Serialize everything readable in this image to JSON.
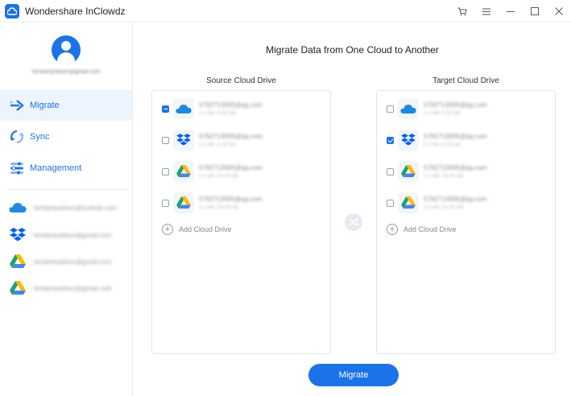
{
  "app": {
    "title": "Wondershare InClowdz"
  },
  "window_controls": [
    "cart-icon",
    "menu-icon",
    "minimize-icon",
    "maximize-icon",
    "close-icon"
  ],
  "sidebar": {
    "user_email": "kimberlywilson@gmail.com",
    "nav": [
      {
        "label": "Migrate",
        "icon": "migrate-icon",
        "active": true
      },
      {
        "label": "Sync",
        "icon": "sync-icon",
        "active": false
      },
      {
        "label": "Management",
        "icon": "management-icon",
        "active": false
      }
    ],
    "accounts": [
      {
        "service": "onedrive",
        "email": "kimberlywilson@outlook.com"
      },
      {
        "service": "dropbox",
        "email": "kimberlywilson@gmail.com"
      },
      {
        "service": "google-drive",
        "email": "kimberlywilson@gmail.com"
      },
      {
        "service": "google-drive",
        "email": "kimberlywilson@gmail.com"
      }
    ]
  },
  "main": {
    "title": "Migrate Data from One Cloud to Another",
    "source": {
      "label": "Source Cloud Drive",
      "drives": [
        {
          "service": "onedrive",
          "email": "5792713005@qq.com",
          "size": "1.2 GB / 5.00 GB",
          "state": "partial"
        },
        {
          "service": "dropbox",
          "email": "5792713005@qq.com",
          "size": "1.2 GB / 2.00 GB",
          "state": "unchecked"
        },
        {
          "service": "google-drive",
          "email": "5792713005@qq.com",
          "size": "1.2 GB / 15.00 GB",
          "state": "unchecked"
        },
        {
          "service": "google-drive",
          "email": "5792713005@qq.com",
          "size": "1.2 GB / 15.00 GB",
          "state": "unchecked"
        }
      ],
      "add_label": "Add Cloud Drive"
    },
    "target": {
      "label": "Target Cloud Drive",
      "drives": [
        {
          "service": "onedrive",
          "email": "5792713005@qq.com",
          "size": "1.2 GB / 5.00 GB",
          "state": "unchecked"
        },
        {
          "service": "dropbox",
          "email": "5792713005@qq.com",
          "size": "1.2 GB / 2.00 GB",
          "state": "checked"
        },
        {
          "service": "google-drive",
          "email": "5792713005@qq.com",
          "size": "1.2 GB / 15.00 GB",
          "state": "unchecked"
        },
        {
          "service": "google-drive",
          "email": "5792713005@qq.com",
          "size": "1.2 GB / 15.00 GB",
          "state": "unchecked"
        }
      ],
      "add_label": "Add Cloud Drive"
    },
    "migrate_button": "Migrate"
  },
  "colors": {
    "accent": "#1a73e8",
    "onedrive": "#1e88e5",
    "dropbox": "#0061fe",
    "gdrive_green": "#1ea362",
    "gdrive_yellow": "#ffba00",
    "gdrive_blue": "#4285f4"
  }
}
